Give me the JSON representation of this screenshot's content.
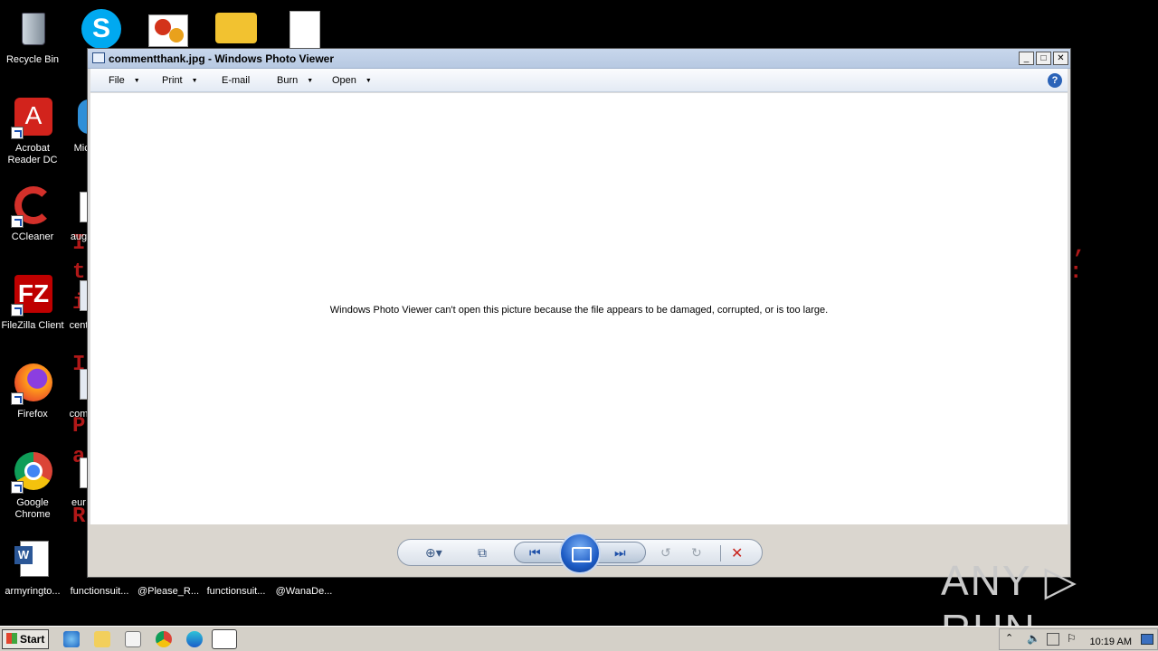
{
  "desktop": {
    "icons": [
      {
        "label": "Recycle Bin"
      },
      {
        "label": "Acrobat Reader DC"
      },
      {
        "label": "CCleaner"
      },
      {
        "label": "FileZilla Client"
      },
      {
        "label": "Firefox"
      },
      {
        "label": "Google Chrome"
      },
      {
        "label": "armyringto..."
      },
      {
        "label": "Micr"
      },
      {
        "label": "aug"
      },
      {
        "label": "cent"
      },
      {
        "label": "com"
      },
      {
        "label": "eur"
      },
      {
        "label": "functionsuit..."
      },
      {
        "label": "@Please_R..."
      },
      {
        "label": "functionsuit..."
      },
      {
        "label": "@WanaDe..."
      }
    ]
  },
  "window": {
    "title": "commentthank.jpg - Windows Photo Viewer",
    "minimize": "_",
    "maximize": "□",
    "close": "✕",
    "menu": [
      "File",
      "Print",
      "E-mail",
      "Burn",
      "Open"
    ],
    "help": "?",
    "message": "Windows Photo Viewer can't open this picture because the file appears to be damaged, corrupted, or is too large."
  },
  "taskbar": {
    "start": "Start",
    "clock": "10:19 AM"
  },
  "watermark": "ANY ▷ RUN"
}
